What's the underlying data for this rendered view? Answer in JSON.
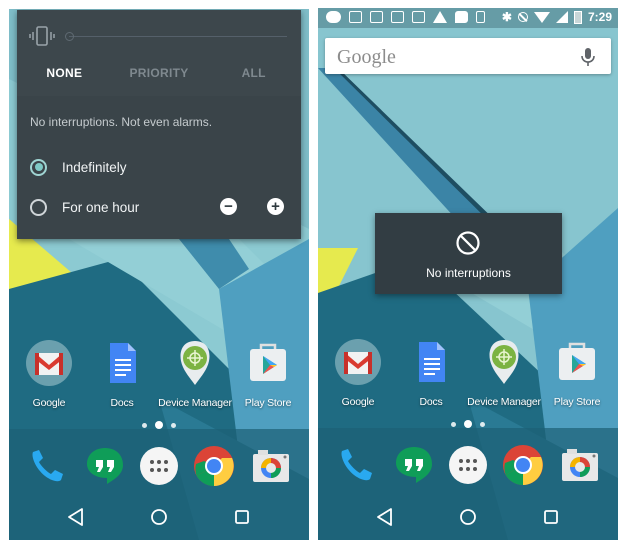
{
  "left_screen": {
    "dnd_panel": {
      "vibrate_icon": "vibrate-icon",
      "tabs": [
        {
          "label": "NONE",
          "active": true
        },
        {
          "label": "PRIORITY",
          "active": false
        },
        {
          "label": "ALL",
          "active": false
        }
      ],
      "message": "No interruptions. Not even alarms.",
      "options": [
        {
          "label": "Indefinitely",
          "selected": true
        },
        {
          "label": "For one hour",
          "selected": false
        }
      ],
      "minus_label": "−",
      "plus_label": "+"
    }
  },
  "right_screen": {
    "status_bar": {
      "notification_icons": [
        "chat-bubble-icon",
        "gmail-icon",
        "image-icon",
        "gmail-icon",
        "gmail-icon",
        "warning-icon",
        "message-icon",
        "phone-download-icon"
      ],
      "system_icons": [
        "bluetooth-icon",
        "do-not-disturb-icon",
        "wifi-icon",
        "signal-icon",
        "battery-charging-icon"
      ],
      "bluetooth_glyph": "✱",
      "time": "7:29"
    },
    "search": {
      "logo_text": "Google",
      "mic_icon": "mic-icon"
    },
    "toast": {
      "icon": "do-not-disturb-icon",
      "text": "No interruptions"
    }
  },
  "home": {
    "apps": [
      {
        "label": "Google",
        "icon": "gmail-icon"
      },
      {
        "label": "Docs",
        "icon": "docs-icon"
      },
      {
        "label": "Device Manager",
        "icon": "device-manager-icon"
      },
      {
        "label": "Play Store",
        "icon": "play-store-icon"
      }
    ],
    "page_indicator": {
      "pages": 3,
      "current": 2
    },
    "dock": [
      "phone-icon",
      "hangouts-icon",
      "app-drawer-icon",
      "chrome-icon",
      "camera-icon"
    ],
    "nav": [
      "back-icon",
      "home-icon",
      "recents-icon"
    ]
  },
  "colors": {
    "panel_bg": "#3a4449",
    "accent_teal": "#7fcac6",
    "toast_bg": "#323d43",
    "wallpaper_light": "#8fc9d0",
    "wallpaper_dark": "#1f6a80",
    "wallpaper_yellow": "#e8ec4a"
  }
}
